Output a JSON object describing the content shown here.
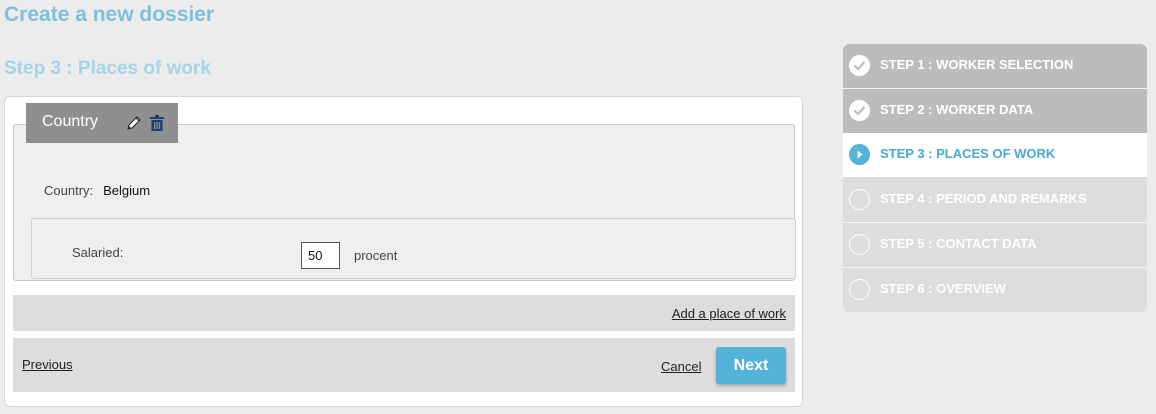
{
  "header": {
    "title": "Create a new dossier",
    "step_title": "Step 3 : Places of work"
  },
  "country_block": {
    "tab_label": "Country",
    "edit_icon": "pencil-icon",
    "delete_icon": "trash-icon",
    "country_label": "Country:",
    "country_value": "Belgium",
    "salaried_label": "Salaried:",
    "salaried_value": "50",
    "salaried_unit": "procent"
  },
  "actions": {
    "add_place": "Add a place of work",
    "previous": "Previous",
    "cancel": "Cancel",
    "next": "Next"
  },
  "steps": [
    {
      "label": "STEP 1 : WORKER SELECTION",
      "status": "done"
    },
    {
      "label": "STEP 2 : WORKER DATA",
      "status": "done"
    },
    {
      "label": "STEP 3 : PLACES OF WORK",
      "status": "active"
    },
    {
      "label": "STEP 4 : PERIOD AND REMARKS",
      "status": "todo"
    },
    {
      "label": "STEP 5 : CONTACT DATA",
      "status": "todo"
    },
    {
      "label": "STEP 6 : OVERVIEW",
      "status": "todo"
    }
  ],
  "colors": {
    "accent": "#55b3d9",
    "title": "#7fbfdc",
    "step_done_bg": "#bcbcbc",
    "step_todo_bg": "#dedcdc"
  }
}
